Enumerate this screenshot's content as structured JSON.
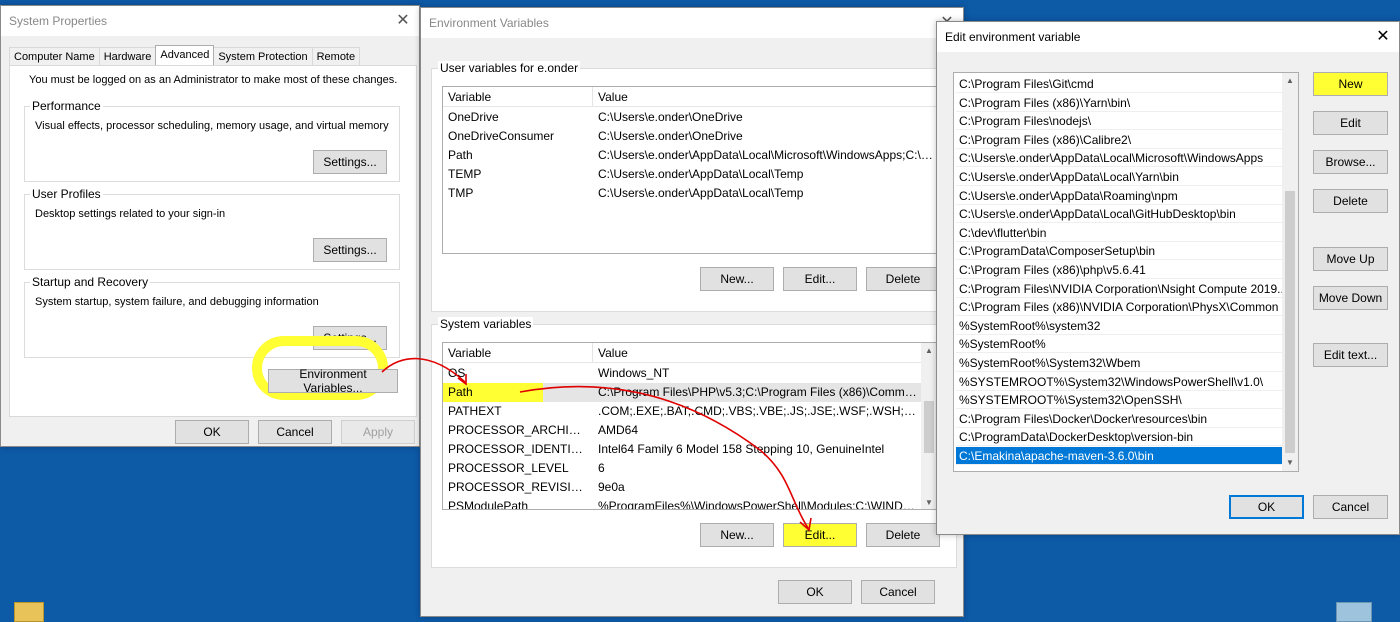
{
  "system_properties": {
    "title": "System Properties",
    "close": "✕",
    "tabs": [
      "Computer Name",
      "Hardware",
      "Advanced",
      "System Protection",
      "Remote"
    ],
    "admin_note": "You must be logged on as an Administrator to make most of these changes.",
    "performance": {
      "label": "Performance",
      "desc": "Visual effects, processor scheduling, memory usage, and virtual memory",
      "button": "Settings..."
    },
    "user_profiles": {
      "label": "User Profiles",
      "desc": "Desktop settings related to your sign-in",
      "button": "Settings..."
    },
    "startup": {
      "label": "Startup and Recovery",
      "desc": "System startup, system failure, and debugging information",
      "button": "Settings..."
    },
    "env_button": "Environment Variables...",
    "ok": "OK",
    "cancel": "Cancel",
    "apply": "Apply"
  },
  "env_vars": {
    "title": "Environment Variables",
    "close": "✕",
    "user_section": "User variables for e.onder",
    "system_section": "System variables",
    "col_variable": "Variable",
    "col_value": "Value",
    "user_rows": [
      {
        "name": "OneDrive",
        "value": "C:\\Users\\e.onder\\OneDrive"
      },
      {
        "name": "OneDriveConsumer",
        "value": "C:\\Users\\e.onder\\OneDrive"
      },
      {
        "name": "Path",
        "value": "C:\\Users\\e.onder\\AppData\\Local\\Microsoft\\WindowsApps;C:\\Us..."
      },
      {
        "name": "TEMP",
        "value": "C:\\Users\\e.onder\\AppData\\Local\\Temp"
      },
      {
        "name": "TMP",
        "value": "C:\\Users\\e.onder\\AppData\\Local\\Temp"
      }
    ],
    "system_rows": [
      {
        "name": "OS",
        "value": "Windows_NT"
      },
      {
        "name": "Path",
        "value": "C:\\Program Files\\PHP\\v5.3;C:\\Program Files (x86)\\Common Fil..."
      },
      {
        "name": "PATHEXT",
        "value": ".COM;.EXE;.BAT;.CMD;.VBS;.VBE;.JS;.JSE;.WSF;.WSH;.MSC"
      },
      {
        "name": "PROCESSOR_ARCHITECTU...",
        "value": "AMD64"
      },
      {
        "name": "PROCESSOR_IDENTIFIER",
        "value": "Intel64 Family 6 Model 158 Stepping 10, GenuineIntel"
      },
      {
        "name": "PROCESSOR_LEVEL",
        "value": "6"
      },
      {
        "name": "PROCESSOR_REVISION",
        "value": "9e0a"
      },
      {
        "name": "PSModulePath",
        "value": "%ProgramFiles%\\WindowsPowerShell\\Modules;C:\\WINDOWS..."
      }
    ],
    "user_buttons": {
      "new": "New...",
      "edit": "Edit...",
      "delete": "Delete"
    },
    "system_buttons": {
      "new": "New...",
      "edit": "Edit...",
      "delete": "Delete"
    },
    "ok": "OK",
    "cancel": "Cancel"
  },
  "edit_env": {
    "title": "Edit environment variable",
    "close": "✕",
    "items": [
      "C:\\Program Files\\Git\\cmd",
      "C:\\Program Files (x86)\\Yarn\\bin\\",
      "C:\\Program Files\\nodejs\\",
      "C:\\Program Files (x86)\\Calibre2\\",
      "C:\\Users\\e.onder\\AppData\\Local\\Microsoft\\WindowsApps",
      "C:\\Users\\e.onder\\AppData\\Local\\Yarn\\bin",
      "C:\\Users\\e.onder\\AppData\\Roaming\\npm",
      "C:\\Users\\e.onder\\AppData\\Local\\GitHubDesktop\\bin",
      "C:\\dev\\flutter\\bin",
      "C:\\ProgramData\\ComposerSetup\\bin",
      "C:\\Program Files (x86)\\php\\v5.6.41",
      "C:\\Program Files\\NVIDIA Corporation\\Nsight Compute 2019....",
      "C:\\Program Files (x86)\\NVIDIA Corporation\\PhysX\\Common",
      "%SystemRoot%\\system32",
      "%SystemRoot%",
      "%SystemRoot%\\System32\\Wbem",
      "%SYSTEMROOT%\\System32\\WindowsPowerShell\\v1.0\\",
      "%SYSTEMROOT%\\System32\\OpenSSH\\",
      "C:\\Program Files\\Docker\\Docker\\resources\\bin",
      "C:\\ProgramData\\DockerDesktop\\version-bin",
      "C:\\Emakina\\apache-maven-3.6.0\\bin"
    ],
    "selected_index": 20,
    "buttons": {
      "new": "New",
      "edit": "Edit",
      "browse": "Browse...",
      "delete": "Delete",
      "move_up": "Move Up",
      "move_down": "Move Down",
      "edit_text": "Edit text..."
    },
    "ok": "OK",
    "cancel": "Cancel"
  },
  "colors": {
    "desktop": "#0d5aa7",
    "highlight": "#ffff33",
    "selection": "#0078d7",
    "annotation_arrow": "#e00000"
  }
}
